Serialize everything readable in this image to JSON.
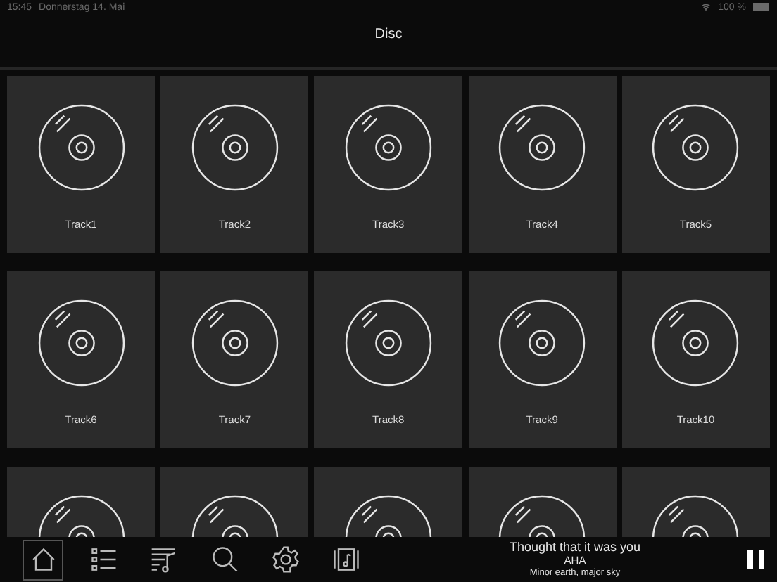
{
  "status_bar": {
    "time": "15:45",
    "date": "Donnerstag 14. Mai",
    "battery": "100 %"
  },
  "header": {
    "title": "Disc"
  },
  "tiles": [
    {
      "kind": "disc",
      "label": "Track1"
    },
    {
      "kind": "disc",
      "label": "Track2"
    },
    {
      "kind": "disc",
      "label": "Track3"
    },
    {
      "kind": "disc",
      "label": "Track4"
    },
    {
      "kind": "disc",
      "label": "Track5"
    },
    {
      "kind": "disc",
      "label": "Track6"
    },
    {
      "kind": "disc",
      "label": "Track7"
    },
    {
      "kind": "disc",
      "label": "Track8"
    },
    {
      "kind": "disc",
      "label": "Track9"
    },
    {
      "kind": "disc",
      "label": "Track10"
    },
    {
      "kind": "disc"
    },
    {
      "kind": "disc"
    },
    {
      "kind": "disc"
    },
    {
      "kind": "disc"
    },
    {
      "kind": "disc"
    }
  ],
  "tab_bar": [
    {
      "kind": "home",
      "selected": true
    },
    {
      "kind": "list",
      "selected": false
    },
    {
      "kind": "playlist",
      "selected": false
    },
    {
      "kind": "search",
      "selected": false
    },
    {
      "kind": "settings",
      "selected": false
    },
    {
      "kind": "album",
      "selected": false
    }
  ],
  "now_playing": {
    "title": "Thought that it was you",
    "artist": "AHA",
    "album": "Minor earth, major sky",
    "playing": true
  }
}
